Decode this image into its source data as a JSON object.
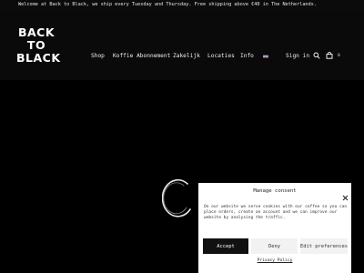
{
  "announcement": "Welcome at Back to Black, we ship every Tuesday and Thursday. Free shipping above €40 in The Netherlands.",
  "logo": {
    "line1": "BACK",
    "line2": "TO",
    "line3": "BLACK"
  },
  "nav": {
    "items": [
      "Shop",
      "Koffie Abonnement",
      "Zakelijk",
      "Locaties",
      "Info"
    ],
    "language_icon": "flag-nl-icon",
    "signin": "Sign in",
    "search_icon": "search-icon",
    "cart_icon": "cart-icon",
    "cart_count": "0"
  },
  "loader_icon": "loading-spinner-icon",
  "consent": {
    "title": "Manage consent",
    "text": "On our website we serve cookies   with our coffee so you can place orders, create an account and we can improve our website by analysing the traffic.",
    "accept": "Accept",
    "deny": "Deny",
    "preferences": "Edit preferences",
    "policy": "Privacy Policy",
    "close_icon": "close-icon"
  },
  "colors": {
    "background": "#000000",
    "header": "#0a0a0a",
    "panel": "#ffffff",
    "accept": "#111111"
  }
}
